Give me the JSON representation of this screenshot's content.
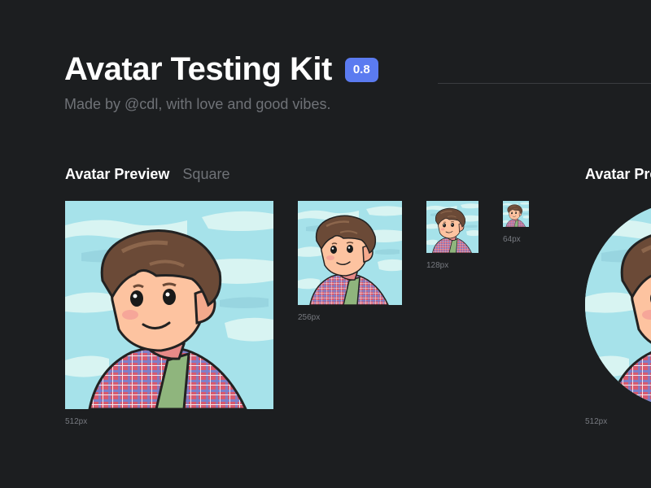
{
  "header": {
    "title": "Avatar Testing Kit",
    "version": "0.8",
    "subtitle": "Made by @cdl, with love and good vibes."
  },
  "sections": {
    "square": {
      "title": "Avatar Preview",
      "shape_label": "Square",
      "sizes": [
        "512px",
        "256px",
        "128px",
        "64px"
      ]
    },
    "circle": {
      "title": "Avatar Preview",
      "sizes": [
        "512px"
      ]
    }
  },
  "colors": {
    "background": "#1c1e20",
    "accent": "#5b7bf0",
    "sky": "#a6e2ea",
    "hair": "#6b4a37",
    "skin": "#fdc3a0",
    "shirt": "#d85a6e"
  },
  "icons": {
    "avatar": "cartoon-portrait-icon"
  }
}
